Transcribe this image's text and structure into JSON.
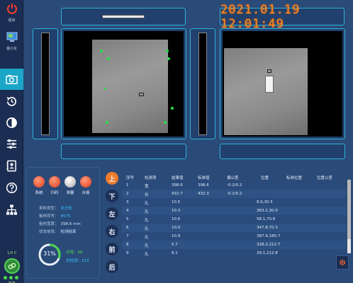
{
  "sidebar": {
    "exit_label": "退出",
    "minimize_label": "最小化",
    "conn_count": "1/4 0",
    "conn_label": "连接",
    "nav_icons": [
      "camera-icon",
      "history-icon",
      "contrast-icon",
      "sliders-icon",
      "contacts-icon",
      "help-icon",
      "network-icon"
    ]
  },
  "clock": "2021.01.19  12:01:49",
  "status": {
    "lamps": [
      {
        "label": "系统",
        "color": "#f04a2a"
      },
      {
        "label": "扫码",
        "color": "#f04a2a"
      },
      {
        "label": "测量",
        "color": "#cfcfcf"
      },
      {
        "label": "合格",
        "color": "#f04a2a"
      }
    ],
    "info": [
      {
        "key": "来料类型：",
        "value": "长方形",
        "blue": true
      },
      {
        "key": "板材序号：",
        "value": "8575",
        "blue": true
      },
      {
        "key": "板材宽度：",
        "value": "398.6 mm",
        "blue": false
      },
      {
        "key": "状态信息：",
        "value": "检测结束",
        "blue": false
      }
    ],
    "progress_percent": 31,
    "progress_label": "31%",
    "pass_label": "合格：",
    "pass_value": "68",
    "total_label": "总检测：",
    "total_value": "213"
  },
  "tabs": [
    "上",
    "下",
    "左",
    "右",
    "前",
    "后"
  ],
  "table": {
    "headers": [
      "序号",
      "检测项",
      "结果值",
      "标准值",
      "偏公差",
      "位置",
      "标准位置",
      "位置公差"
    ],
    "rows": [
      [
        "1",
        "宽",
        "398.6",
        "398.6",
        "-0.2/0.2",
        "",
        "",
        ""
      ],
      [
        "2",
        "长",
        "432.7",
        "432.3",
        "-0.2/0.2",
        "",
        "",
        ""
      ],
      [
        "3",
        "孔",
        "10.5",
        "",
        "",
        "8.6,30.5",
        "",
        ""
      ],
      [
        "4",
        "孔",
        "10.3",
        "",
        "",
        "363.2,30.0",
        "",
        ""
      ],
      [
        "5",
        "孔",
        "10.6",
        "",
        "",
        "58.1,70.8",
        "",
        ""
      ],
      [
        "6",
        "孔",
        "10.0",
        "",
        "",
        "347.8,70.3",
        "",
        ""
      ],
      [
        "7",
        "孔",
        "10.9",
        "",
        "",
        "387.9,180.7",
        "",
        ""
      ],
      [
        "8",
        "孔",
        "5.7",
        "",
        "",
        "328.2,212.7",
        "",
        ""
      ],
      [
        "9",
        "孔",
        "6.1",
        "",
        "",
        "39.1,212.8",
        "",
        ""
      ]
    ]
  }
}
